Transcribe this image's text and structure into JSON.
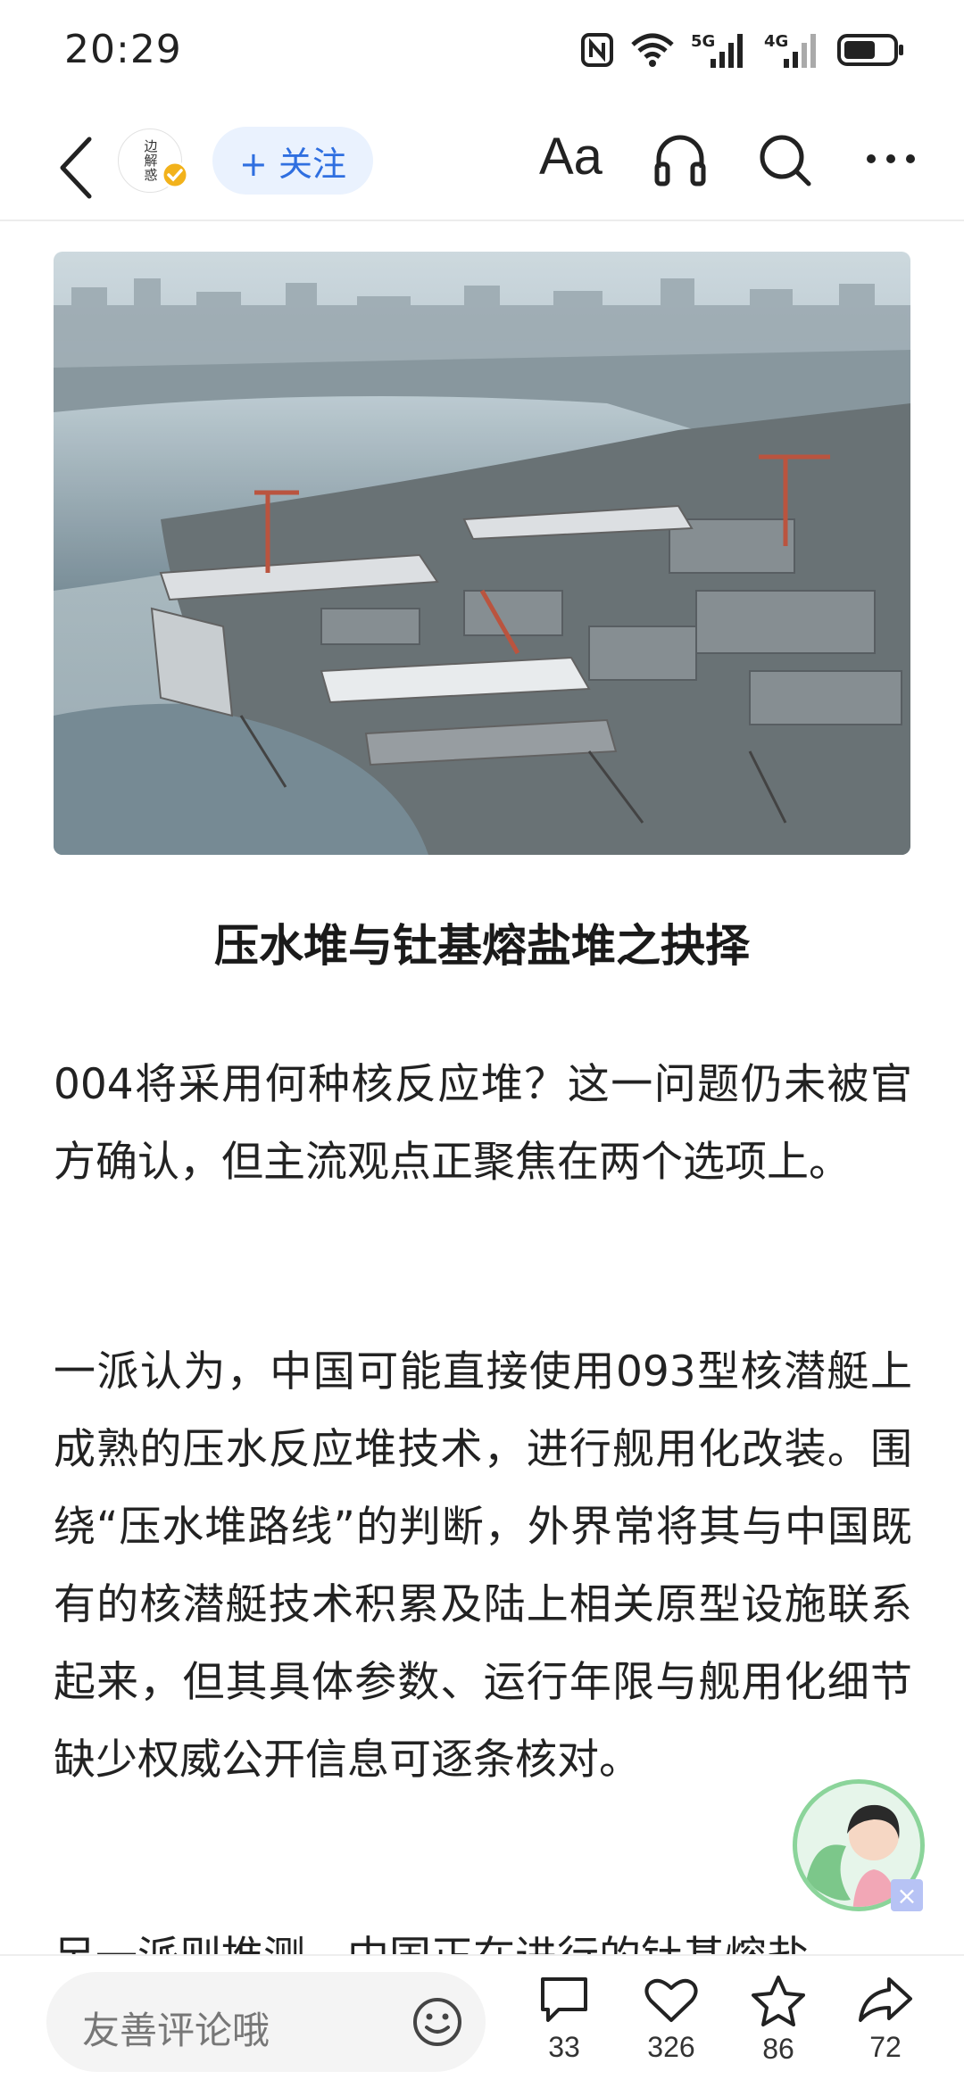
{
  "status_bar": {
    "time": "20:29",
    "icons": [
      "nfc-icon",
      "wifi-icon",
      "signal-5g-icon",
      "signal-4g-icon",
      "battery-icon"
    ],
    "network_labels": [
      "5G",
      "4G"
    ]
  },
  "nav": {
    "author_avatar_text": "边解惑",
    "follow_label": "+ 关注",
    "font_size_label": "Aa",
    "accent_color": "#2f6fe0",
    "follow_bg_color": "#eaf2fe"
  },
  "article": {
    "section_heading": "压水堆与钍基熔盐堆之抉择",
    "paragraphs": [
      "004将采用何种核反应堆？这一问题仍未被官方确认，但主流观点正聚焦在两个选项上。",
      "一派认为，中国可能直接使用093型核潜艇上成熟的压水反应堆技术，进行舰用化改装。围绕“压水堆路线”的判断，外界常将其与中国既有的核潜艇技术积累及陆上相关原型设施联系起来，但其具体参数、运行年限与舰用化细节缺少权威公开信息可逐条核对。",
      "另一派则推测，中国正在进行的钍基熔盐"
    ]
  },
  "bottom_bar": {
    "comment_placeholder": "友善评论哦",
    "comment_count": "33",
    "like_count": "326",
    "favorite_count": "86",
    "share_count": "72"
  }
}
